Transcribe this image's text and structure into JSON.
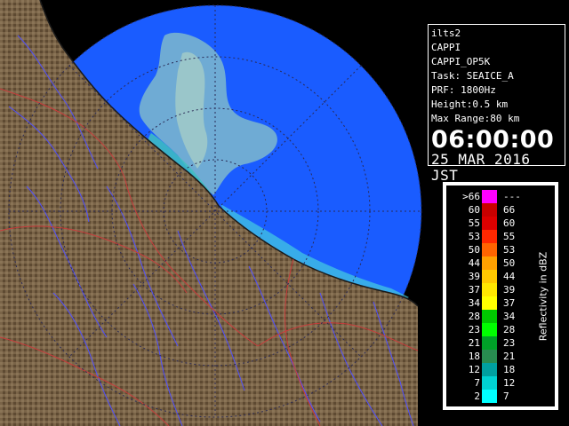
{
  "info": {
    "site": "ilts2",
    "product": "CAPPI",
    "product_id": "CAPPI_OP5K",
    "task": "Task: SEAICE_A",
    "prf": "PRF: 1800Hz",
    "height": "Height:0.5 km",
    "max_range": "Max Range:80 km",
    "time": "06:00:00",
    "date": "25 MAR 2016 JST"
  },
  "legend": {
    "title": "Reflectivity in dBZ",
    "rows": [
      {
        "lo": ">66",
        "hi": "---",
        "color": "#ff00ff"
      },
      {
        "lo": "60",
        "hi": "66",
        "color": "#c80000"
      },
      {
        "lo": "55",
        "hi": "60",
        "color": "#dc0000"
      },
      {
        "lo": "53",
        "hi": "55",
        "color": "#ff2800"
      },
      {
        "lo": "50",
        "hi": "53",
        "color": "#ff6400"
      },
      {
        "lo": "44",
        "hi": "50",
        "color": "#ffa000"
      },
      {
        "lo": "39",
        "hi": "44",
        "color": "#ffc800"
      },
      {
        "lo": "37",
        "hi": "39",
        "color": "#ffe600"
      },
      {
        "lo": "34",
        "hi": "37",
        "color": "#ffff00"
      },
      {
        "lo": "28",
        "hi": "34",
        "color": "#00c800"
      },
      {
        "lo": "23",
        "hi": "28",
        "color": "#00ff00"
      },
      {
        "lo": "21",
        "hi": "23",
        "color": "#00a028"
      },
      {
        "lo": "18",
        "hi": "21",
        "color": "#288c50"
      },
      {
        "lo": "12",
        "hi": "18",
        "color": "#00a0a0"
      },
      {
        "lo": "7",
        "hi": "12",
        "color": "#00d2d2"
      },
      {
        "lo": "2",
        "hi": "7",
        "color": "#00ffff"
      }
    ]
  },
  "map_colors": {
    "background": "#000000",
    "radar_disc": "#1a5cff",
    "land": "#7a6448",
    "land_shade": "#5a4630",
    "river": "#5050ff",
    "boundary": "#c83c3c",
    "range_ring": "#333366",
    "echo_light": "#8ec8d8",
    "echo_teal": "#40c8c8"
  }
}
